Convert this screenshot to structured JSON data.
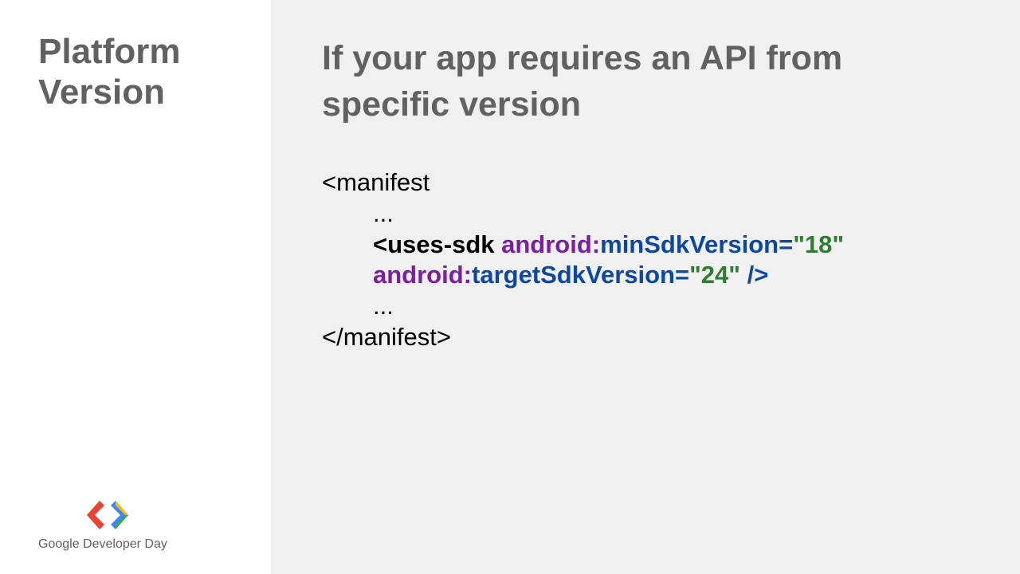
{
  "sidebar": {
    "title_line1": "Platform",
    "title_line2": "Version",
    "footer_text": "Google Developer Day"
  },
  "main": {
    "heading": "If your app requires an API from specific version",
    "code": {
      "open_tag": "<manifest",
      "ellipsis": "...",
      "uses_sdk_open": "<uses-sdk ",
      "attr1_ns": "android:",
      "attr1_name": "minSdkVersion",
      "attr1_eq": "=",
      "attr1_val": "\"18\"",
      "attr2_ns": "android:",
      "attr2_name": "targetSdkVersion",
      "attr2_eq": "=",
      "attr2_val": "\"24\"",
      "self_close": " />",
      "close_tag": "</manifest>"
    }
  }
}
